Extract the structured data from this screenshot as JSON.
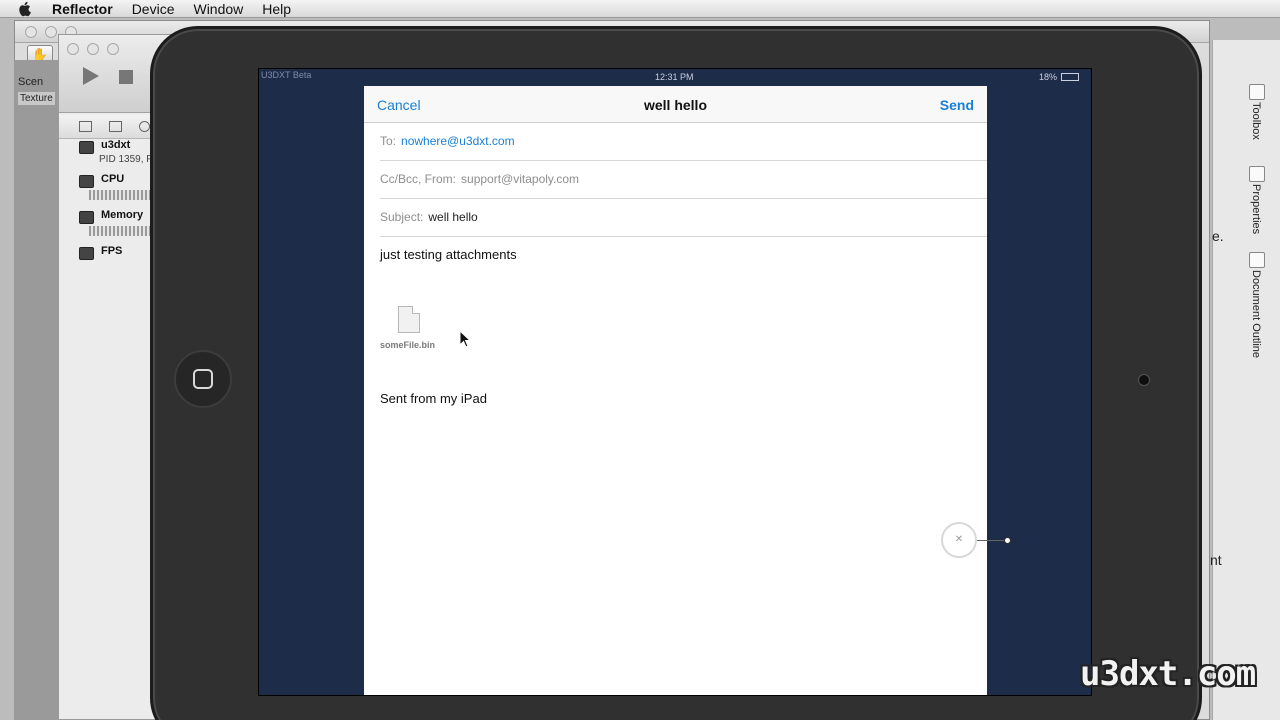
{
  "menubar": {
    "app": "Reflector",
    "items": [
      "Device",
      "Window",
      "Help"
    ]
  },
  "xcode": {
    "scene_tab": "Scen",
    "texture_tab": "Texture",
    "profiler": {
      "rows": [
        {
          "label": "u3dxt",
          "sub": "PID 1359, P",
          "icon": "app-icon"
        },
        {
          "label": "CPU",
          "icon": "cpu-icon"
        },
        {
          "label": "Memory",
          "icon": "memory-icon"
        },
        {
          "label": "FPS",
          "icon": "fps-icon"
        }
      ]
    },
    "inspector": {
      "tabs": [
        "Toolbox",
        "Properties",
        "Document Outline"
      ],
      "partial_text_1": "e.",
      "partial_text_2": "nt"
    }
  },
  "ipad": {
    "status": {
      "carrier": "U3DXT Beta",
      "time": "12:31 PM",
      "battery": "18%"
    },
    "mail": {
      "cancel": "Cancel",
      "title": "well hello",
      "send": "Send",
      "to_label": "To:",
      "to_value": "nowhere@u3dxt.com",
      "ccbcc_label": "Cc/Bcc, From:",
      "ccbcc_value": "support@vitapoly.com",
      "subject_label": "Subject:",
      "subject_value": "well hello",
      "body": "just testing attachments",
      "attachment_name": "someFile.bin",
      "signature": "Sent from my iPad"
    }
  },
  "watermark": "u3dxt.com",
  "colors": {
    "link_blue": "#1a7fd6",
    "ipad_wallpaper": "#1d2c48",
    "bezel": "#303030"
  }
}
